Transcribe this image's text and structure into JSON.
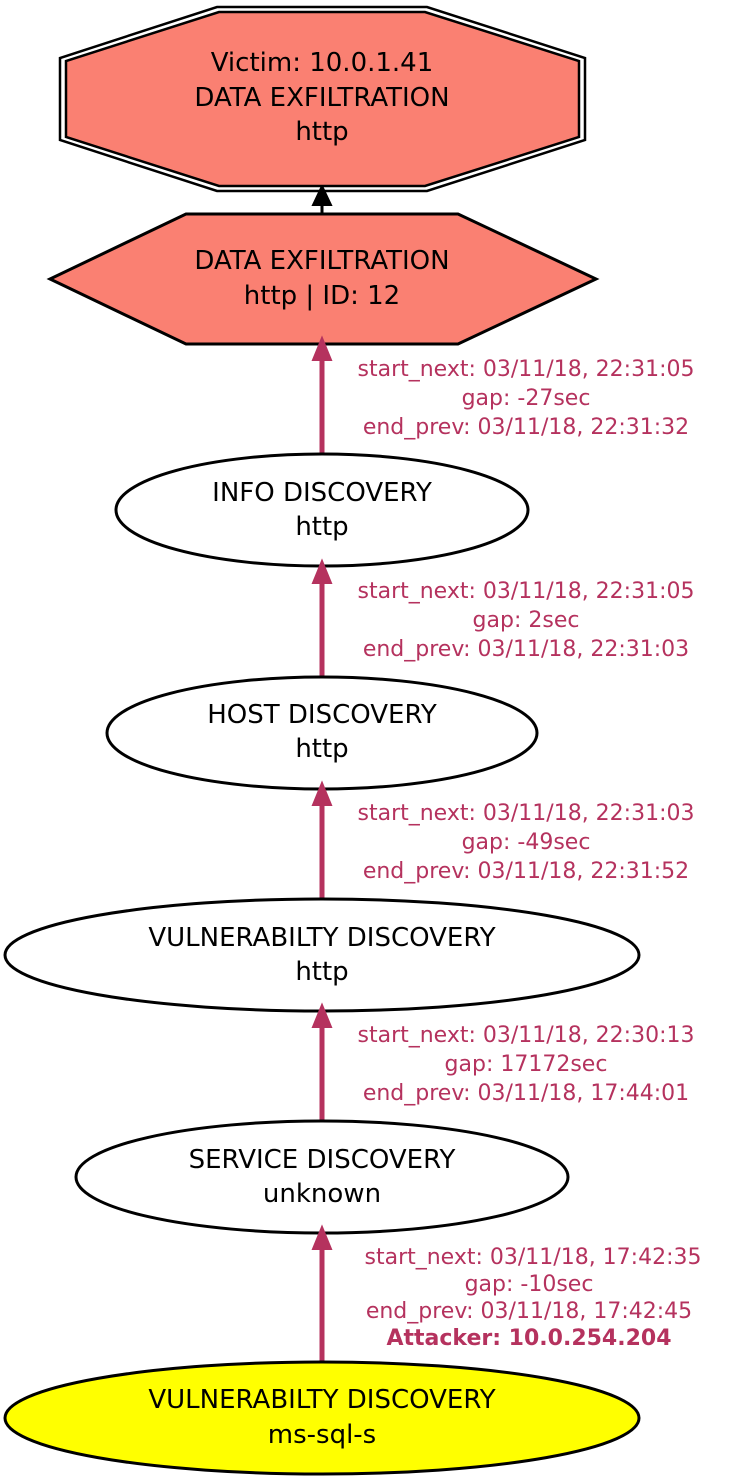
{
  "colors": {
    "edge": "#b5325e",
    "victim_fill": "#fa8072",
    "exfil_fill": "#fa8072",
    "attacker_fill": "#ffff00",
    "node_fill": "#ffffff",
    "stroke": "#000000"
  },
  "nodes": {
    "victim": {
      "line1": "Victim: 10.0.1.41",
      "line2": "DATA EXFILTRATION",
      "line3": "http"
    },
    "exfil": {
      "line1": "DATA EXFILTRATION",
      "line2": "http | ID: 12"
    },
    "info": {
      "line1": "INFO DISCOVERY",
      "line2": "http"
    },
    "host": {
      "line1": "HOST DISCOVERY",
      "line2": "http"
    },
    "vuln": {
      "line1": "VULNERABILTY DISCOVERY",
      "line2": "http"
    },
    "service": {
      "line1": "SERVICE DISCOVERY",
      "line2": "unknown"
    },
    "attacker": {
      "line1": "VULNERABILTY DISCOVERY",
      "line2": "ms-sql-s"
    }
  },
  "edges": [
    {
      "start": "start_next: 03/11/18, 22:31:05",
      "gap": "gap: -27sec",
      "end": "end_prev: 03/11/18, 22:31:32"
    },
    {
      "start": "start_next: 03/11/18, 22:31:05",
      "gap": "gap: 2sec",
      "end": "end_prev: 03/11/18, 22:31:03"
    },
    {
      "start": "start_next: 03/11/18, 22:31:03",
      "gap": "gap: -49sec",
      "end": "end_prev: 03/11/18, 22:31:52"
    },
    {
      "start": "start_next: 03/11/18, 22:30:13",
      "gap": "gap: 17172sec",
      "end": "end_prev: 03/11/18, 17:44:01"
    },
    {
      "start": "start_next: 03/11/18, 17:42:35",
      "gap": "gap: -10sec",
      "end": "end_prev: 03/11/18, 17:42:45",
      "attacker": "Attacker: 10.0.254.204"
    }
  ]
}
